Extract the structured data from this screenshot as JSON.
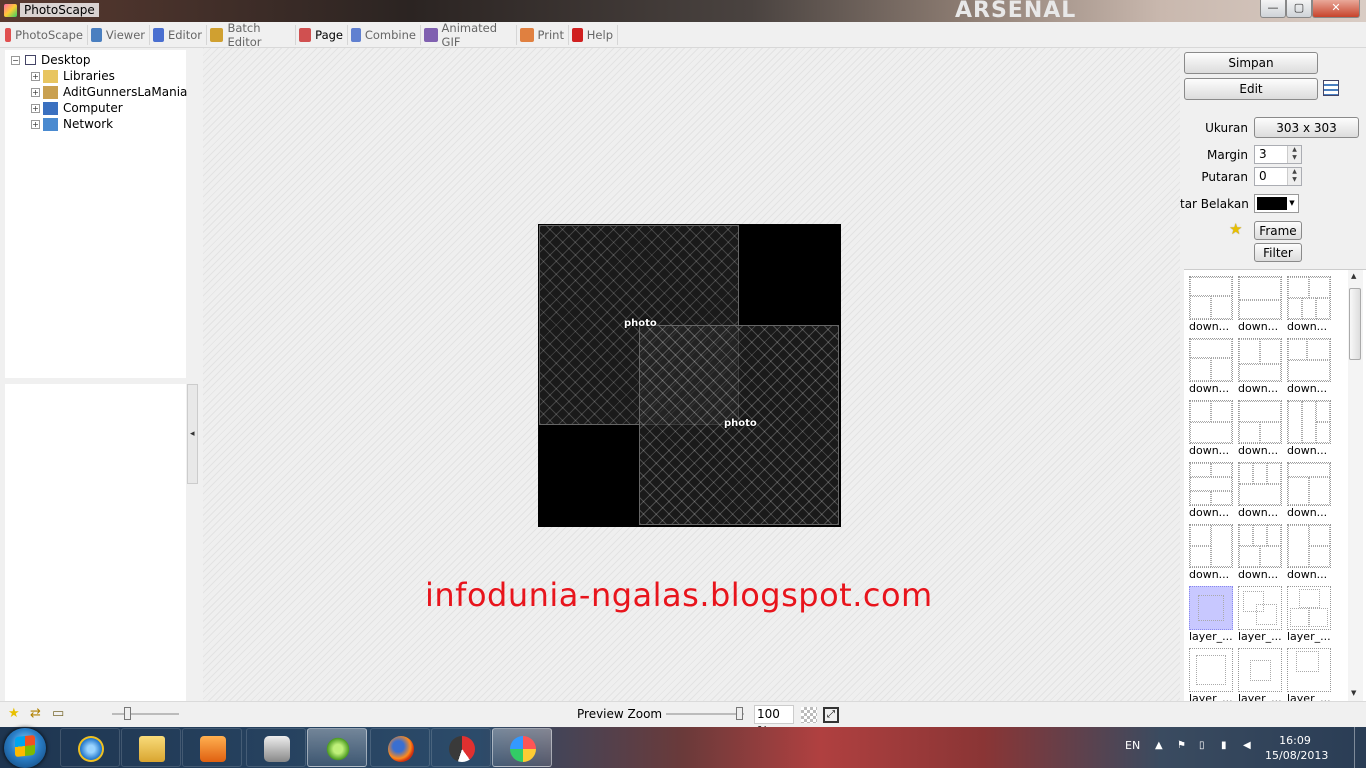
{
  "window": {
    "title": "PhotoScape",
    "bg_watermark": "ARSENAL",
    "controls": {
      "minimize": "—",
      "maximize": "▢",
      "close": "✕"
    }
  },
  "tabs": [
    {
      "label": "PhotoScape",
      "icon": "photoscape-icon",
      "color": "#e05050"
    },
    {
      "label": "Viewer",
      "icon": "viewer-icon",
      "color": "#4a7fc0"
    },
    {
      "label": "Editor",
      "icon": "editor-icon",
      "color": "#4a6fd0"
    },
    {
      "label": "Batch Editor",
      "icon": "batch-editor-icon",
      "color": "#d0a030"
    },
    {
      "label": "Page",
      "icon": "page-icon",
      "color": "#d05050",
      "active": true
    },
    {
      "label": "Combine",
      "icon": "combine-icon",
      "color": "#6080d0"
    },
    {
      "label": "Animated GIF",
      "icon": "animated-gif-icon",
      "color": "#8060b0"
    },
    {
      "label": "Print",
      "icon": "print-icon",
      "color": "#e08040"
    },
    {
      "label": "Help",
      "icon": "help-icon",
      "color": "#d02020"
    }
  ],
  "tree": {
    "root": "Desktop",
    "items": [
      {
        "label": "Libraries",
        "icon": "libraries-folder-icon"
      },
      {
        "label": "AditGunnersLaMania",
        "icon": "user-folder-icon"
      },
      {
        "label": "Computer",
        "icon": "computer-icon"
      },
      {
        "label": "Network",
        "icon": "network-icon"
      }
    ]
  },
  "collage": {
    "placeholder_label": "photo",
    "size": "303 x 303"
  },
  "blog_text": "infodunia-ngalas.blogspot.com",
  "right_panel": {
    "save_label": "Simpan",
    "edit_label": "Edit",
    "size_label": "Ukuran",
    "size_value": "303 x 303",
    "margin_label": "Margin",
    "margin_value": "3",
    "rotation_label": "Putaran",
    "rotation_value": "0",
    "background_label": "tar Belakang",
    "background_color": "#000000",
    "frame_label": "Frame",
    "filter_label": "Filter"
  },
  "templates": [
    {
      "caption": "down..."
    },
    {
      "caption": "down..."
    },
    {
      "caption": "down..."
    },
    {
      "caption": "down..."
    },
    {
      "caption": "down..."
    },
    {
      "caption": "down..."
    },
    {
      "caption": "down..."
    },
    {
      "caption": "down..."
    },
    {
      "caption": "down..."
    },
    {
      "caption": "down..."
    },
    {
      "caption": "down..."
    },
    {
      "caption": "down..."
    },
    {
      "caption": "down..."
    },
    {
      "caption": "down..."
    },
    {
      "caption": "down..."
    },
    {
      "caption": "layer_...",
      "selected": true
    },
    {
      "caption": "layer_..."
    },
    {
      "caption": "layer_..."
    },
    {
      "caption": "layer_..."
    },
    {
      "caption": "layer_..."
    },
    {
      "caption": "layer_..."
    }
  ],
  "statusbar": {
    "preview_zoom_label": "Preview Zoom",
    "zoom_value": "100 %"
  },
  "taskbar": {
    "apps": [
      "internet-explorer-icon",
      "windows-explorer-icon",
      "media-player-icon",
      "camera-icon",
      "greenish-app-icon",
      "firefox-icon",
      "photo-app-icon",
      "paint-icon"
    ],
    "language": "EN",
    "time": "16:09",
    "date": "15/08/2013"
  }
}
